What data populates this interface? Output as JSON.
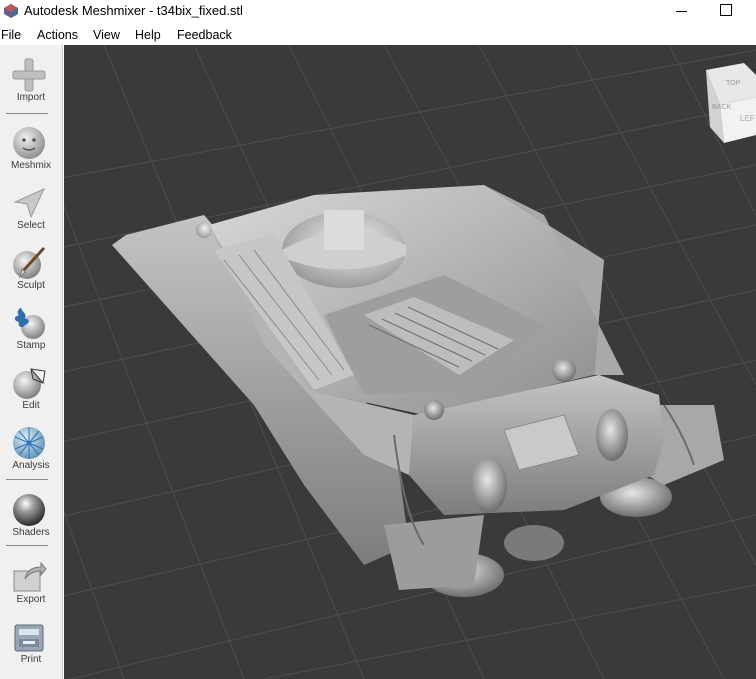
{
  "window": {
    "title": "Autodesk Meshmixer - t34bix_fixed.stl",
    "icon": "meshmixer-logo-icon"
  },
  "menu": {
    "items": [
      "File",
      "Actions",
      "View",
      "Help",
      "Feedback"
    ]
  },
  "toolbar": {
    "tools": [
      {
        "label": "Import",
        "icon": "plus-icon"
      },
      {
        "label": "Meshmix",
        "icon": "face-icon"
      },
      {
        "label": "Select",
        "icon": "arrow-cursor-icon"
      },
      {
        "label": "Sculpt",
        "icon": "brush-icon"
      },
      {
        "label": "Stamp",
        "icon": "stamp-icon"
      },
      {
        "label": "Edit",
        "icon": "edit-sphere-icon"
      },
      {
        "label": "Analysis",
        "icon": "analysis-mesh-icon"
      },
      {
        "label": "Shaders",
        "icon": "shader-sphere-icon"
      },
      {
        "label": "Export",
        "icon": "export-icon"
      },
      {
        "label": "Print",
        "icon": "printer-icon"
      }
    ]
  },
  "viewport": {
    "background": "#3a3a3a",
    "model": "t34bix_fixed.stl",
    "view_cube": {
      "faces": [
        "TOP",
        "LEFT",
        "BACK"
      ]
    }
  },
  "colors": {
    "toolbar_bg": "#f0f0f0",
    "grid_line": "#4e4e4e",
    "model": "#bdbdbd"
  }
}
